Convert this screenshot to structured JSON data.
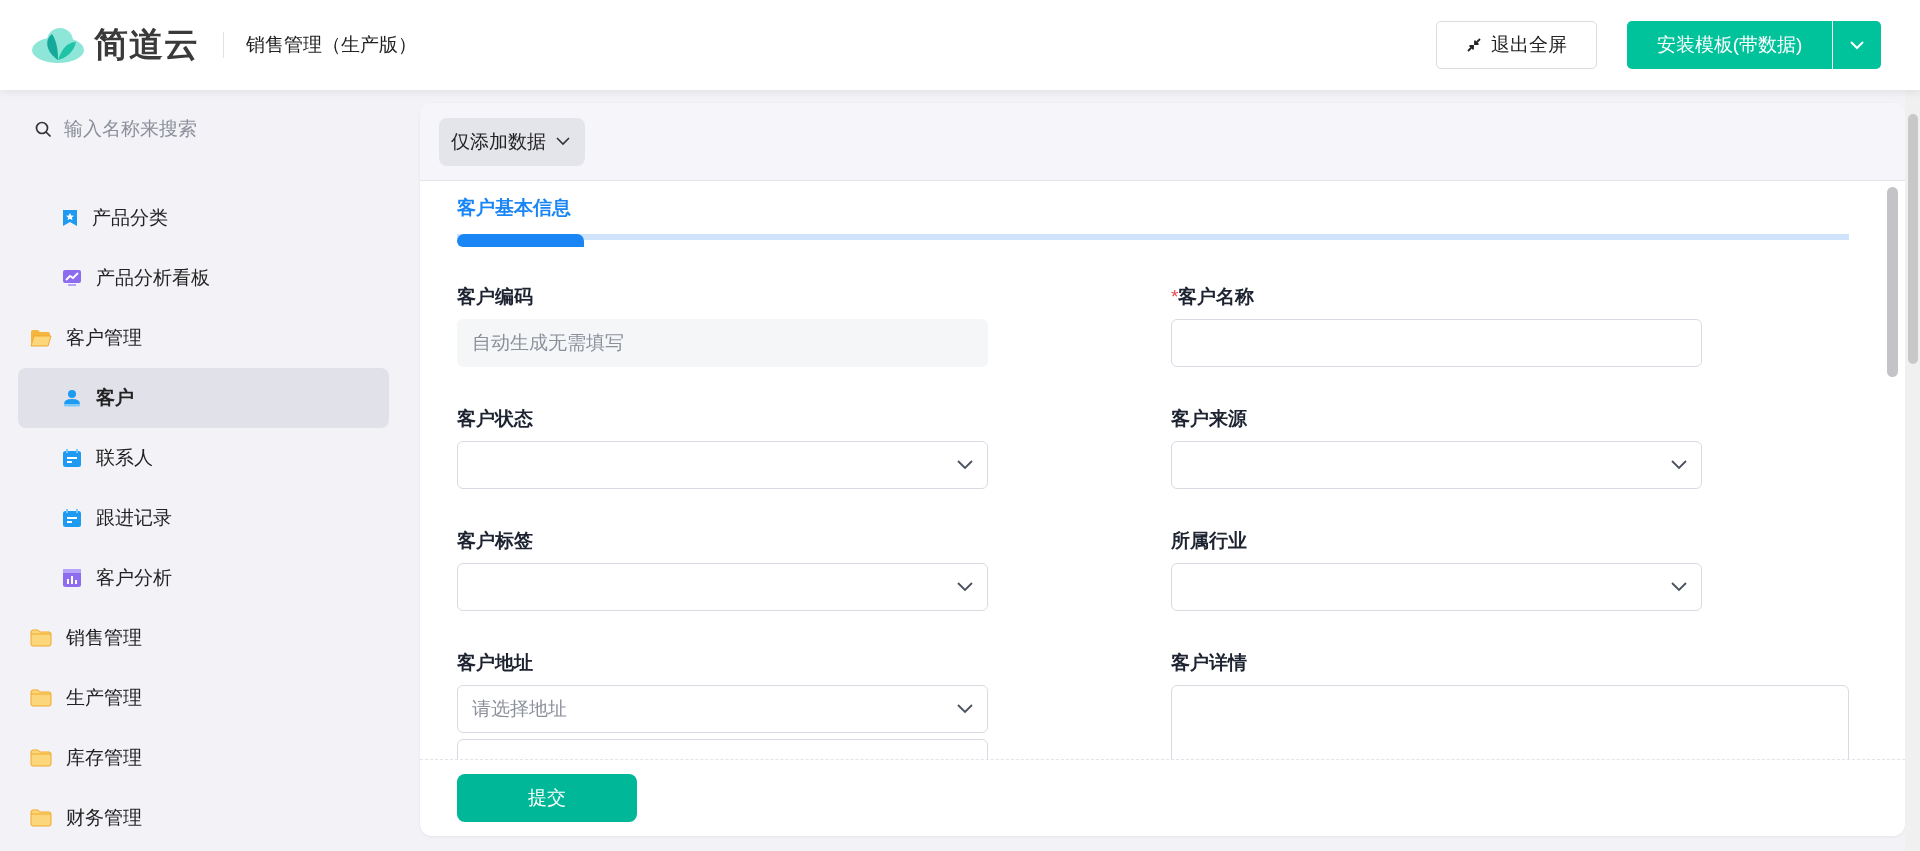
{
  "header": {
    "brand": "简道云",
    "app_title": "销售管理（生产版）",
    "exit_fullscreen": "退出全屏",
    "install_button": "安装模板(带数据)"
  },
  "sidebar": {
    "search": {
      "placeholder": "输入名称来搜索"
    },
    "items": [
      {
        "kind": "group-continued",
        "children": [
          {
            "label": "产品分类",
            "kind": "bookmark",
            "selected": false
          },
          {
            "label": "产品分析看板",
            "kind": "board",
            "selected": false
          }
        ]
      },
      {
        "kind": "folder",
        "label": "客户管理",
        "expanded": true,
        "children": [
          {
            "label": "客户",
            "kind": "person",
            "selected": true
          },
          {
            "label": "联系人",
            "kind": "form",
            "selected": false
          },
          {
            "label": "跟进记录",
            "kind": "form",
            "selected": false
          },
          {
            "label": "客户分析",
            "kind": "report",
            "selected": false
          }
        ]
      },
      {
        "kind": "folder",
        "label": "销售管理",
        "expanded": false
      },
      {
        "kind": "folder",
        "label": "生产管理",
        "expanded": false
      },
      {
        "kind": "folder",
        "label": "库存管理",
        "expanded": false
      },
      {
        "kind": "folder",
        "label": "财务管理",
        "expanded": false
      }
    ]
  },
  "form": {
    "mode_dropdown": "仅添加数据",
    "section_tab": "客户基本信息",
    "fields": [
      {
        "label": "客户编码",
        "kind": "readonly",
        "placeholder": "自动生成无需填写"
      },
      {
        "label": "客户名称",
        "required_mark": "*",
        "kind": "text"
      },
      {
        "label": "客户状态",
        "kind": "select"
      },
      {
        "label": "客户来源",
        "kind": "select"
      },
      {
        "label": "客户标签",
        "kind": "select"
      },
      {
        "label": "所属行业",
        "kind": "select"
      },
      {
        "label": "客户地址",
        "kind": "address",
        "placeholder": "请选择地址"
      },
      {
        "label": "客户详情",
        "kind": "textarea"
      }
    ],
    "submit": "提交"
  }
}
